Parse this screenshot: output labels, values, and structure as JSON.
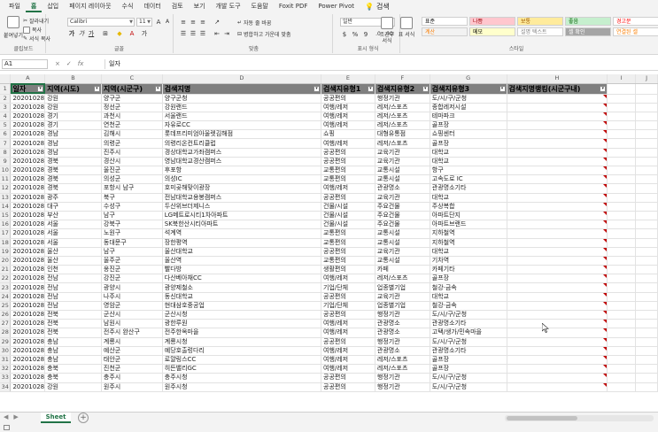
{
  "ribbon_tabs": [
    "파일",
    "홈",
    "삽입",
    "페이지 레이아웃",
    "수식",
    "데이터",
    "검토",
    "보기",
    "개발 도구",
    "도움말",
    "Foxit PDF",
    "Power Pivot"
  ],
  "active_tab_index": 1,
  "tell_me": "검색",
  "clipboard": {
    "paste": "붙여넣기",
    "cut": "잘라내기",
    "copy": "복사",
    "format_painter": "서식 복사",
    "label": "클립보드"
  },
  "font": {
    "name": "Calibri",
    "size": "11",
    "label": "글꼴",
    "bold": "가",
    "italic": "가",
    "underline": "가"
  },
  "alignment": {
    "wrap": "자동 줄 바꿈",
    "merge": "병합하고 가운데 맞춤",
    "label": "맞춤"
  },
  "number": {
    "format": "일반",
    "label": "표시 형식",
    "currency": "$",
    "percent": "%",
    "comma": "9"
  },
  "styles": {
    "conditional": "조건부 서식",
    "table": "표 서식",
    "label": "스타일",
    "cells": [
      {
        "text": "표준",
        "bg": "#ffffff",
        "fg": "#000000"
      },
      {
        "text": "나쁨",
        "bg": "#ffc7ce",
        "fg": "#9c0006"
      },
      {
        "text": "보통",
        "bg": "#ffeb9c",
        "fg": "#9c5700"
      },
      {
        "text": "좋음",
        "bg": "#c6efce",
        "fg": "#006100"
      },
      {
        "text": "경고문",
        "bg": "#ffffff",
        "fg": "#ff0000"
      },
      {
        "text": "계산",
        "bg": "#f2f2f2",
        "fg": "#fa7d00"
      },
      {
        "text": "메모",
        "bg": "#ffffcc",
        "fg": "#000000"
      },
      {
        "text": "설명 텍스트",
        "bg": "#ffffff",
        "fg": "#7f7f7f"
      },
      {
        "text": "셀 확인",
        "bg": "#a5a5a5",
        "fg": "#ffffff"
      },
      {
        "text": "연결된 셀",
        "bg": "#ffffff",
        "fg": "#fa7d00"
      }
    ]
  },
  "formula_bar": {
    "name_box": "A1",
    "cancel": "×",
    "enter": "✓",
    "fx": "fx",
    "content": "일자"
  },
  "columns": [
    "A",
    "B",
    "C",
    "D",
    "E",
    "F",
    "G",
    "H",
    "I",
    "J"
  ],
  "header_row": [
    "일자",
    "지역(시도)",
    "지역(시군구)",
    "검색지명",
    "검색지유형1",
    "검색지유형2",
    "검색지유형3",
    "검색지명랭킹(시군구내)"
  ],
  "rows": [
    [
      "20201028",
      "강원",
      "양구군",
      "양구군청",
      "공공편의",
      "행정기관",
      "도/시/구/군청"
    ],
    [
      "20201028",
      "강원",
      "정선군",
      "강원랜드",
      "여행/레저",
      "레저/스포츠",
      "종합레저시설"
    ],
    [
      "20201028",
      "경기",
      "과천시",
      "서울랜드",
      "여행/레저",
      "레저/스포츠",
      "테마파크"
    ],
    [
      "20201028",
      "경기",
      "연천군",
      "자유로CC",
      "여행/레저",
      "레저/스포츠",
      "골프장"
    ],
    [
      "20201028",
      "경남",
      "김해시",
      "롯데프리미엄아울렛김해점",
      "쇼핑",
      "대형유통점",
      "쇼핑센터"
    ],
    [
      "20201028",
      "경남",
      "의령군",
      "의령리온컨트리클럽",
      "여행/레저",
      "레저/스포츠",
      "골프장"
    ],
    [
      "20201028",
      "경남",
      "진주시",
      "경상대학교가좌캠퍼스",
      "공공편의",
      "교육기관",
      "대학교"
    ],
    [
      "20201028",
      "경북",
      "경산시",
      "영남대학교경산캠퍼스",
      "공공편의",
      "교육기관",
      "대학교"
    ],
    [
      "20201028",
      "경북",
      "울진군",
      "후포항",
      "교통편의",
      "교통시설",
      "항구"
    ],
    [
      "20201028",
      "경북",
      "의성군",
      "의성IC",
      "교통편의",
      "교통시설",
      "고속도로 IC"
    ],
    [
      "20201028",
      "경북",
      "포항시 남구",
      "호미곶해맞이광장",
      "여행/레저",
      "관광명소",
      "관광명소기타"
    ],
    [
      "20201028",
      "광주",
      "북구",
      "전남대학교용봉캠퍼스",
      "공공편의",
      "교육기관",
      "대학교"
    ],
    [
      "20201028",
      "대구",
      "수성구",
      "두산위브더제니스",
      "건물/시설",
      "주요건물",
      "주상복합"
    ],
    [
      "20201028",
      "부산",
      "남구",
      "LG메트로시티1차아파트",
      "건물/시설",
      "주요건물",
      "아파트단지"
    ],
    [
      "20201028",
      "서울",
      "강북구",
      "SK북한산시티아파트",
      "건물/시설",
      "주요건물",
      "아파트브랜드"
    ],
    [
      "20201028",
      "서울",
      "노원구",
      "석계역",
      "교통편의",
      "교통시설",
      "지하철역"
    ],
    [
      "20201028",
      "서울",
      "동대문구",
      "장한평역",
      "교통편의",
      "교통시설",
      "지하철역"
    ],
    [
      "20201028",
      "울산",
      "남구",
      "울산대학교",
      "공공편의",
      "교육기관",
      "대학교"
    ],
    [
      "20201028",
      "울산",
      "울주군",
      "울산역",
      "교통편의",
      "교통시설",
      "기차역"
    ],
    [
      "20201028",
      "인천",
      "옹진군",
      "빨다방",
      "생활편의",
      "카페",
      "카페기타"
    ],
    [
      "20201028",
      "전남",
      "강진군",
      "다산베아채CC",
      "여행/레저",
      "레저/스포츠",
      "골프장"
    ],
    [
      "20201028",
      "전남",
      "광양시",
      "광양제철소",
      "기업/단체",
      "업종별기업",
      "철강·금속"
    ],
    [
      "20201028",
      "전남",
      "나주시",
      "동신대학교",
      "공공편의",
      "교육기관",
      "대학교"
    ],
    [
      "20201028",
      "전남",
      "영암군",
      "현대삼호중공업",
      "기업/단체",
      "업종별기업",
      "철강·금속"
    ],
    [
      "20201028",
      "전북",
      "군산시",
      "군산시청",
      "공공편의",
      "행정기관",
      "도/시/구/군청"
    ],
    [
      "20201028",
      "전북",
      "남원시",
      "광한루원",
      "여행/레저",
      "관광명소",
      "관광명소기타"
    ],
    [
      "20201028",
      "전북",
      "전주시 완산구",
      "전주한옥마을",
      "여행/레저",
      "관광명소",
      "고택/생가/민속마을"
    ],
    [
      "20201028",
      "충남",
      "계룡시",
      "계룡시청",
      "공공편의",
      "행정기관",
      "도/시/구/군청"
    ],
    [
      "20201028",
      "충남",
      "예산군",
      "예당호출렁다리",
      "여행/레저",
      "관광명소",
      "관광명소기타"
    ],
    [
      "20201028",
      "충남",
      "태안군",
      "로얄링스CC",
      "여행/레저",
      "레저/스포츠",
      "골프장"
    ],
    [
      "20201028",
      "충북",
      "진천군",
      "히든밸리GC",
      "여행/레저",
      "레저/스포츠",
      "골프장"
    ],
    [
      "20201028",
      "충북",
      "충주시",
      "충주시청",
      "공공편의",
      "행정기관",
      "도/시/구/군청"
    ],
    [
      "20201028",
      "강원",
      "원주시",
      "원주시청",
      "공공편의",
      "행정기관",
      "도/시/구/군청"
    ]
  ],
  "sheet": {
    "name": "Sheet",
    "add": "+"
  }
}
